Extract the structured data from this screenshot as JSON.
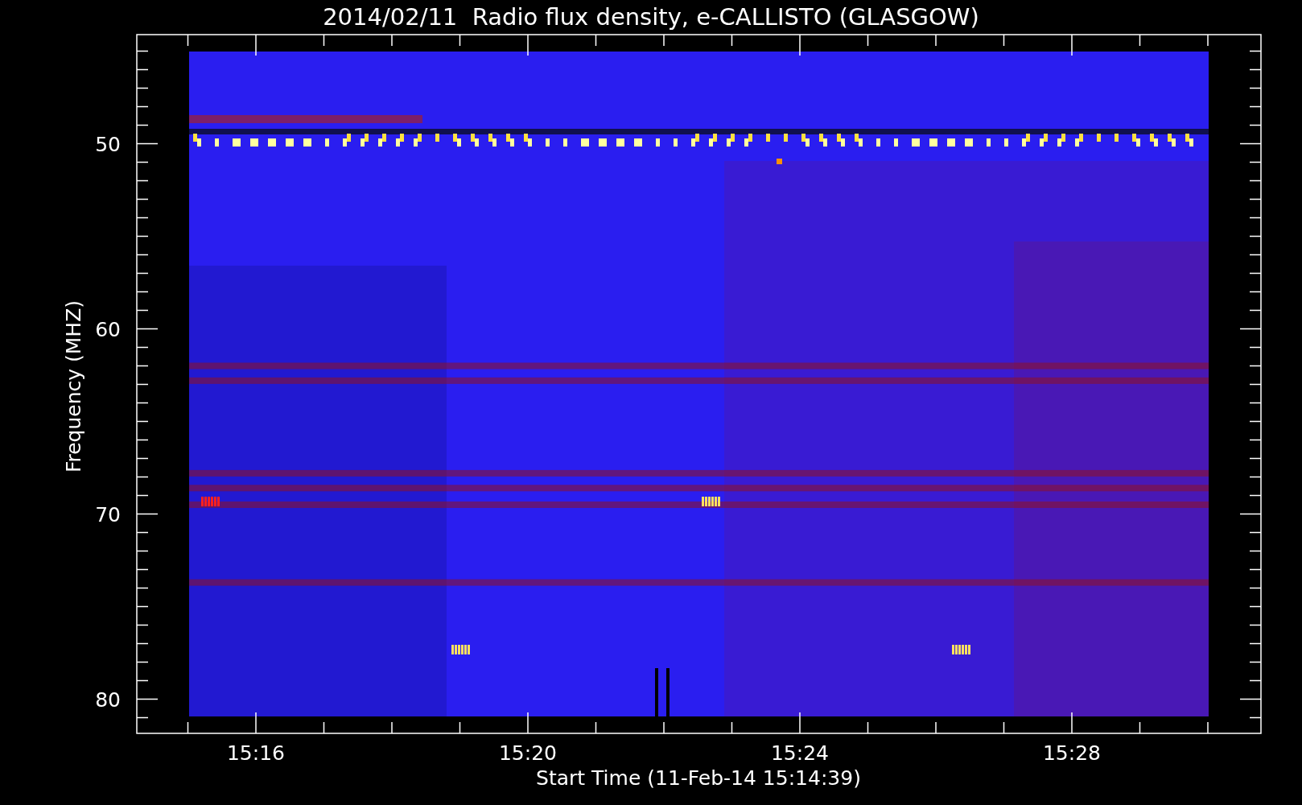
{
  "title": "2014/02/11  Radio flux density, e-CALLISTO (GLASGOW)",
  "plot": {
    "ylabel": "Frequency (MHZ)",
    "xlabel": "Start Time (11-Feb-14 15:14:39)",
    "yticks": [
      "50",
      "60",
      "70",
      "80"
    ],
    "xticks": [
      "15:16",
      "15:20",
      "15:24",
      "15:28"
    ]
  }
}
